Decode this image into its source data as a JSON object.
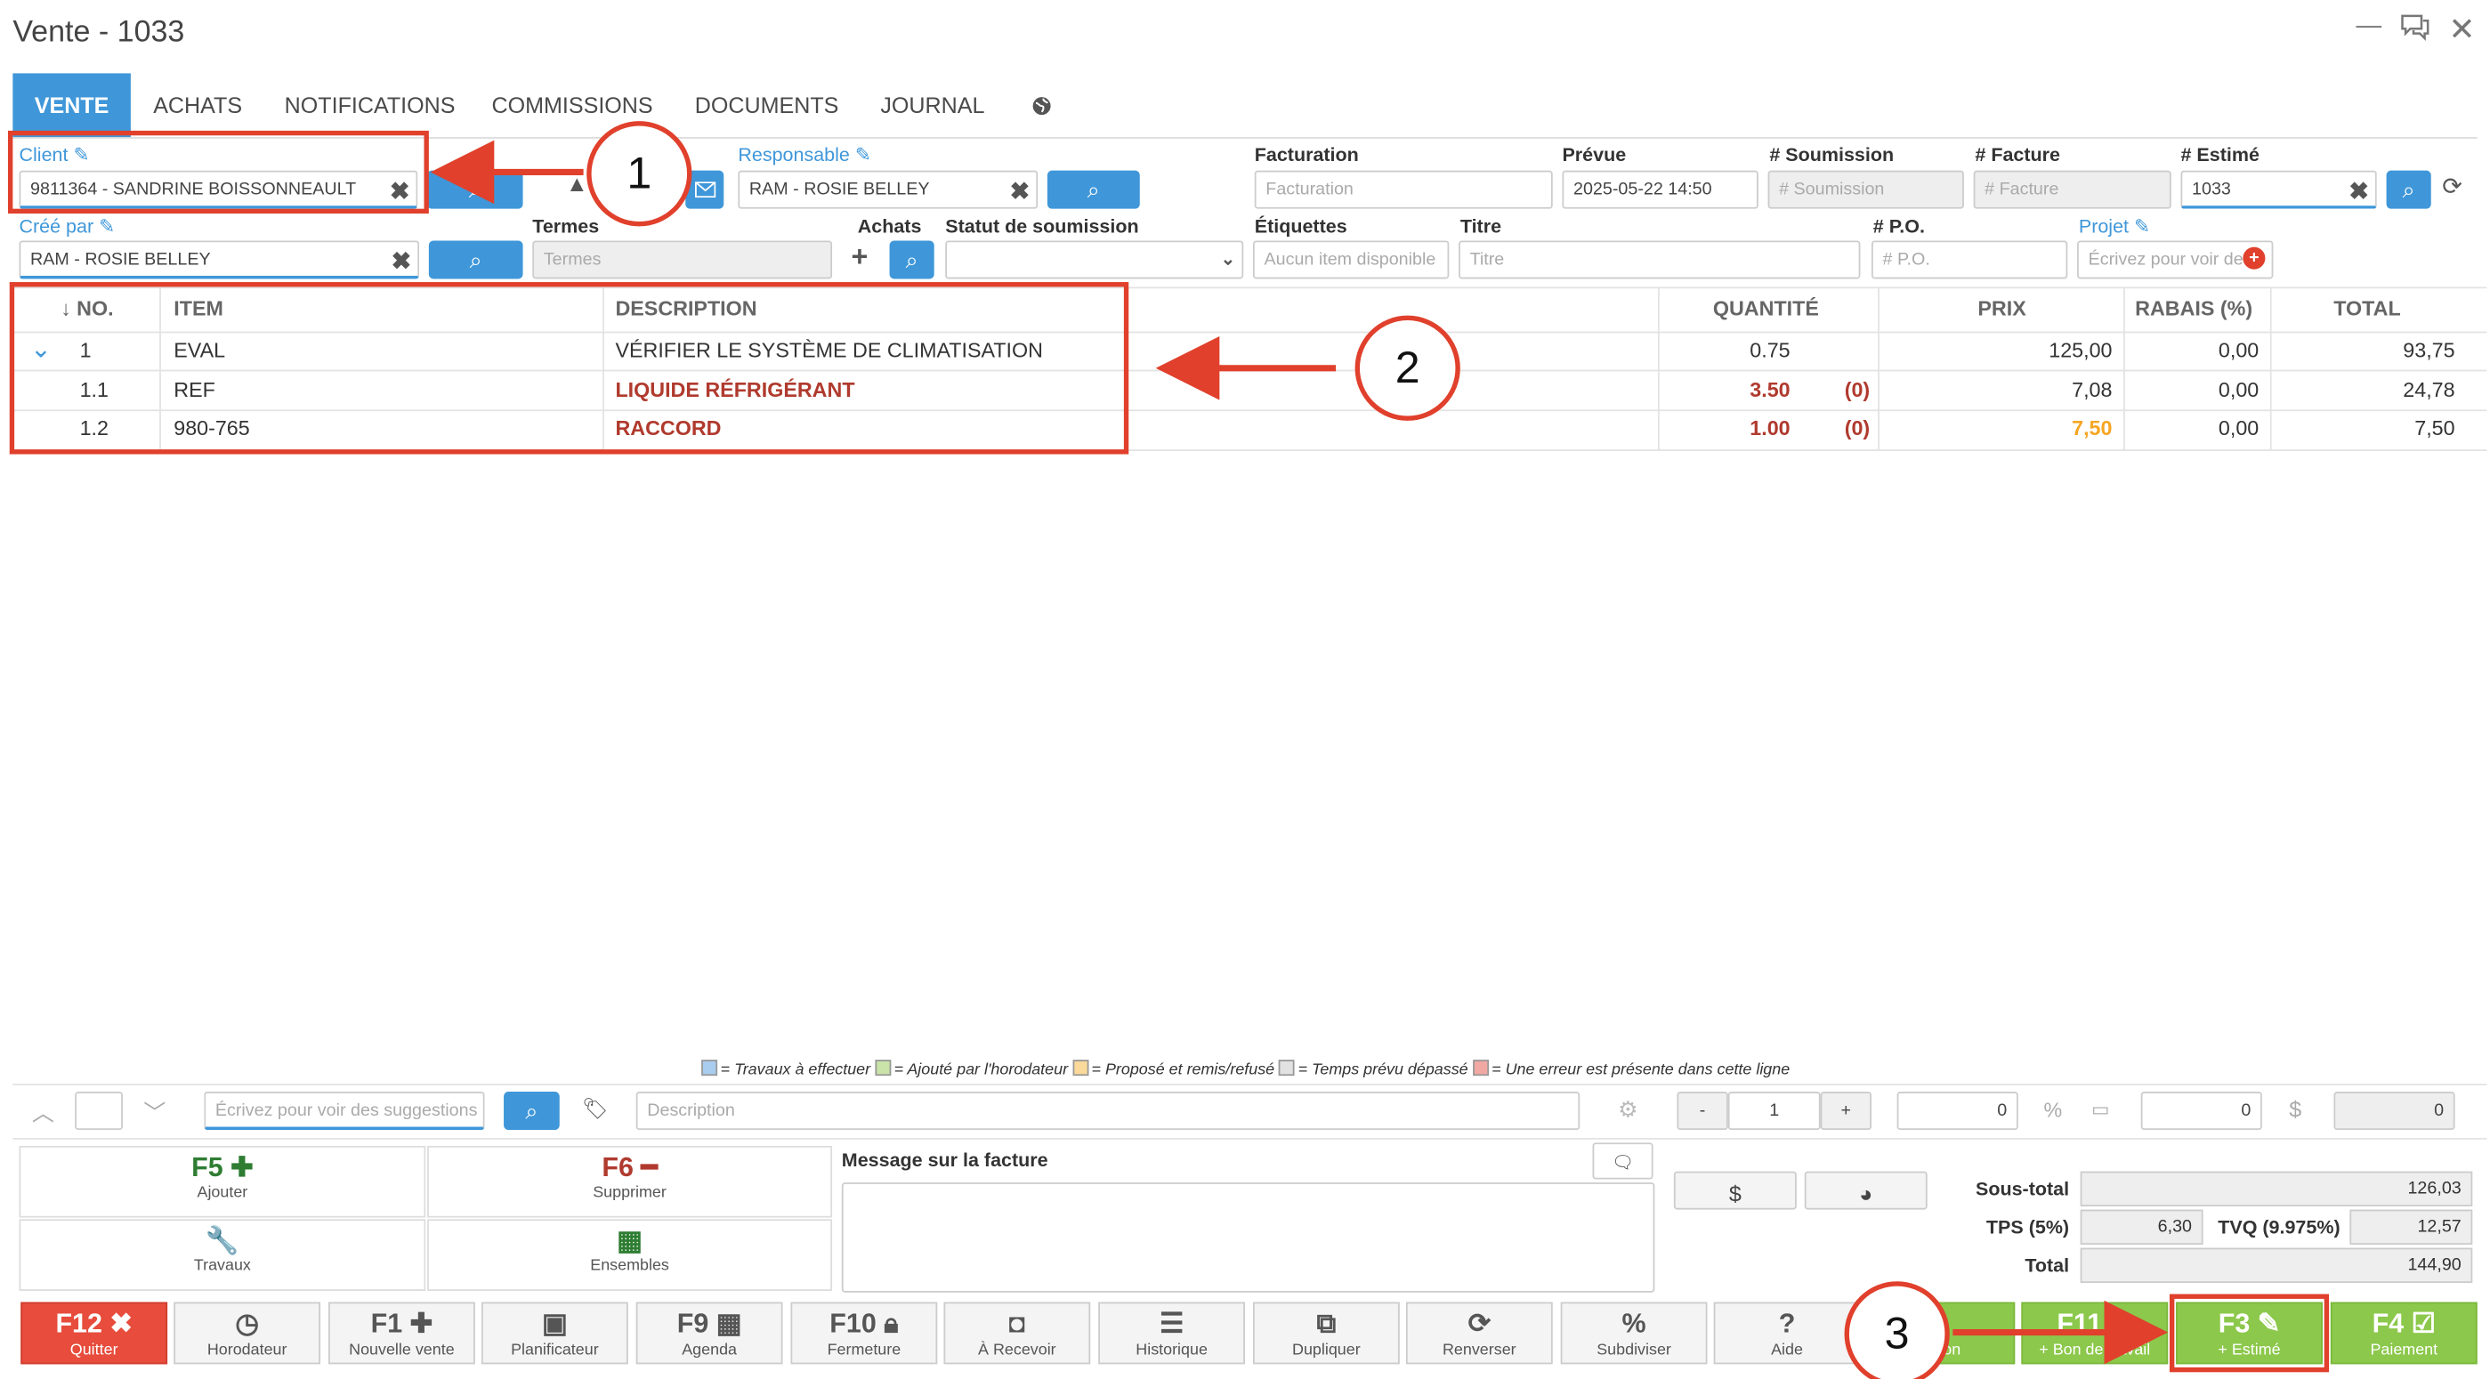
{
  "window": {
    "title": "Vente - 1033"
  },
  "tabs": [
    "VENTE",
    "ACHATS",
    "NOTIFICATIONS",
    "COMMISSIONS",
    "DOCUMENTS",
    "JOURNAL"
  ],
  "form": {
    "client_label": "Client",
    "client_value": "9811364 - SANDRINE BOISSONNEAULT",
    "responsable_label": "Responsable",
    "responsable_value": "RAM - ROSIE BELLEY",
    "facturation_label": "Facturation",
    "facturation_placeholder": "Facturation",
    "prevue_label": "Prévue",
    "prevue_value": "2025-05-22 14:50",
    "soumission_label": "# Soumission",
    "soumission_placeholder": "# Soumission",
    "facture_label": "# Facture",
    "facture_placeholder": "# Facture",
    "estime_label": "# Estimé",
    "estime_value": "1033",
    "cree_par_label": "Créé par",
    "cree_par_value": "RAM - ROSIE BELLEY",
    "termes_label": "Termes",
    "termes_placeholder": "Termes",
    "achats_label": "Achats",
    "statut_label": "Statut de soumission",
    "etiquettes_label": "Étiquettes",
    "etiquettes_placeholder": "Aucun item disponible",
    "titre_label": "Titre",
    "titre_placeholder": "Titre",
    "po_label": "# P.O.",
    "po_placeholder": "# P.O.",
    "projet_label": "Projet",
    "projet_placeholder": "Écrivez pour voir des"
  },
  "table": {
    "headers": {
      "no": "↓ NO.",
      "item": "ITEM",
      "description": "DESCRIPTION",
      "quantite": "QUANTITÉ",
      "prix": "PRIX",
      "rabais": "RABAIS (%)",
      "total": "TOTAL"
    },
    "rows": [
      {
        "no": "1",
        "item": "EVAL",
        "description": "VÉRIFIER LE SYSTÈME DE CLIMATISATION",
        "quantite": "0.75",
        "extra": "",
        "prix": "125,00",
        "rabais": "0,00",
        "total": "93,75"
      },
      {
        "no": "1.1",
        "item": "REF",
        "description": "LIQUIDE RÉFRIGÉRANT",
        "quantite": "3.50",
        "extra": "(0)",
        "prix": "7,08",
        "rabais": "0,00",
        "total": "24,78"
      },
      {
        "no": "1.2",
        "item": "980-765",
        "description": "RACCORD",
        "quantite": "1.00",
        "extra": "(0)",
        "prix": "7,50",
        "rabais": "0,00",
        "total": "7,50"
      }
    ]
  },
  "legend": [
    {
      "color": "#a9cdef",
      "text": "= Travaux à effectuer"
    },
    {
      "color": "#c9e3a8",
      "text": "= Ajouté par l'horodateur"
    },
    {
      "color": "#fbd99a",
      "text": "= Proposé et remis/refusé"
    },
    {
      "color": "#e2e2e2",
      "text": "= Temps prévu dépassé"
    },
    {
      "color": "#f2a8a2",
      "text": "= Une erreur est présente dans cette ligne"
    }
  ],
  "entry": {
    "suggest_placeholder": "Écrivez pour voir des suggestions",
    "description_placeholder": "Description",
    "qty_minus": "-",
    "qty": "1",
    "qty_plus": "+",
    "price": "0",
    "percent_sign": "%",
    "discount": "0",
    "dollar_sign": "$",
    "total": "0"
  },
  "actions": {
    "f5_key": "F5",
    "f5_label": "Ajouter",
    "f6_key": "F6",
    "f6_label": "Supprimer",
    "travaux_label": "Travaux",
    "ensembles_label": "Ensembles",
    "message_label": "Message sur la facture"
  },
  "totals": {
    "soustotal_label": "Sous-total",
    "soustotal": "126,03",
    "tps_label": "TPS (5%)",
    "tps": "6,30",
    "tvq_label": "TVQ (9.975%)",
    "tvq": "12,57",
    "total_label": "Total",
    "total": "144,90"
  },
  "commands": [
    {
      "key": "F12",
      "label": "Quitter"
    },
    {
      "key": "",
      "label": "Horodateur"
    },
    {
      "key": "F1",
      "label": "Nouvelle vente"
    },
    {
      "key": "",
      "label": "Planificateur"
    },
    {
      "key": "F9",
      "label": "Agenda"
    },
    {
      "key": "F10",
      "label": "Fermeture"
    },
    {
      "key": "",
      "label": "À Recevoir"
    },
    {
      "key": "",
      "label": "Historique"
    },
    {
      "key": "",
      "label": "Dupliquer"
    },
    {
      "key": "",
      "label": "Renverser"
    },
    {
      "key": "",
      "label": "Subdiviser"
    },
    {
      "key": "?",
      "label": "Aide"
    },
    {
      "key": "",
      "label": "aison"
    },
    {
      "key": "F11",
      "label": "+ Bon de travail"
    },
    {
      "key": "F3",
      "label": "+ Estimé"
    },
    {
      "key": "F4",
      "label": "Paiement"
    }
  ],
  "callouts": [
    "1",
    "2",
    "3"
  ],
  "colors": {
    "accent": "#3f97d9",
    "annotation": "#e0402c",
    "quit": "#e74c3c",
    "green": "#8cc84b"
  }
}
